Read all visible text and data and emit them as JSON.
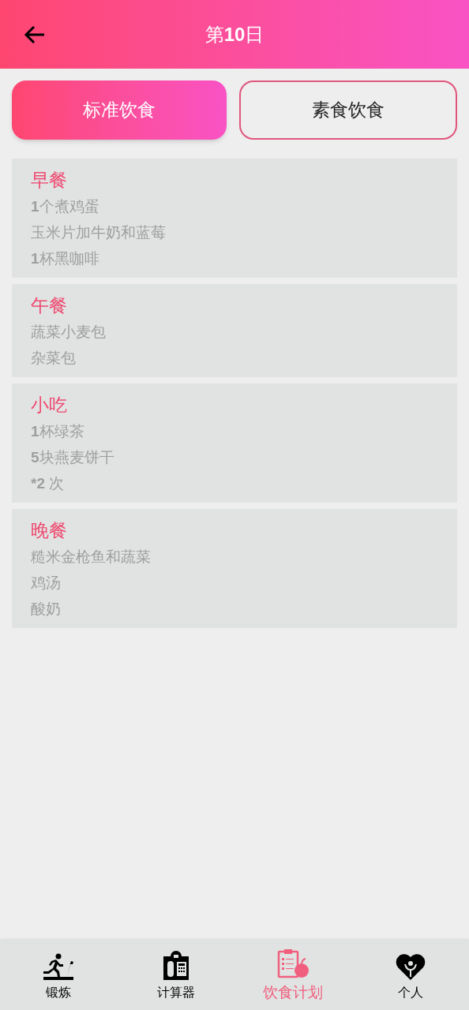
{
  "header": {
    "title": "第**10**日"
  },
  "tabs": [
    {
      "label": "标准饮食",
      "selected": true
    },
    {
      "label": "素食饮食",
      "selected": false
    }
  ],
  "meals": [
    {
      "title": "早餐",
      "items": [
        "**1**个煮鸡蛋",
        "玉米片加牛奶和蓝莓",
        "**1**杯黑咖啡"
      ]
    },
    {
      "title": "午餐",
      "items": [
        "蔬菜小麦包",
        "杂菜包"
      ]
    },
    {
      "title": "小吃",
      "items": [
        "**1**杯绿茶",
        "**5**块燕麦饼干",
        "***2** 次"
      ]
    },
    {
      "title": "晚餐",
      "items": [
        "糙米金枪鱼和蔬菜",
        "鸡汤",
        "酸奶"
      ]
    }
  ],
  "bottom_nav": [
    {
      "label": "锻炼",
      "selected": false
    },
    {
      "label": "计算器",
      "selected": false
    },
    {
      "label": "饮食计划",
      "selected": true
    },
    {
      "label": "个人",
      "selected": false
    }
  ]
}
